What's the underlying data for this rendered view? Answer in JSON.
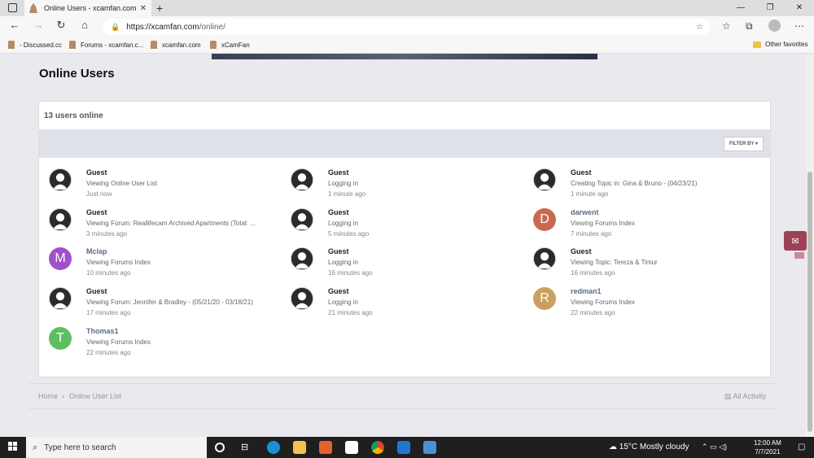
{
  "browser": {
    "tab_title": "Online Users - xcamfan.com",
    "tab_close": "✕",
    "new_tab": "+",
    "url_domain": "https://xcamfan.com",
    "url_path": "/online/",
    "bookmarks": [
      {
        "label": "- Discussed.cc"
      },
      {
        "label": "Forums - xcamfan.c..."
      },
      {
        "label": "xcamfan.com"
      },
      {
        "label": "xCamFan"
      }
    ],
    "other_favorites": "Other favorites"
  },
  "page": {
    "title": "Online Users",
    "count_label": "13 users online",
    "filter_label": "FILTER BY ▾",
    "users": [
      {
        "name": "Guest",
        "activity": "Viewing Online User List",
        "time": "Just now",
        "avatar": "guest",
        "col": 0,
        "row": 0
      },
      {
        "name": "Guest",
        "activity": "Logging in",
        "time": "1 minute ago",
        "avatar": "guest",
        "col": 1,
        "row": 0
      },
      {
        "name": "Guest",
        "activity": "Creating Topic in: Gina & Bruno - (04/23/21)",
        "time": "1 minute ago",
        "avatar": "guest",
        "col": 2,
        "row": 0
      },
      {
        "name": "Guest",
        "activity": "Viewing Forum: Reallifecam Archived Apartments (Total: ...",
        "time": "3 minutes ago",
        "avatar": "guest",
        "col": 0,
        "row": 1
      },
      {
        "name": "Guest",
        "activity": "Logging in",
        "time": "5 minutes ago",
        "avatar": "guest",
        "col": 1,
        "row": 1
      },
      {
        "name": "darwent",
        "activity": "Viewing Forums Index",
        "time": "7 minutes ago",
        "avatar": "D",
        "color": "#c96a50",
        "col": 2,
        "row": 1
      },
      {
        "name": "Mclap",
        "activity": "Viewing Forums Index",
        "time": "10 minutes ago",
        "avatar": "M",
        "color": "#a050c8",
        "col": 0,
        "row": 2
      },
      {
        "name": "Guest",
        "activity": "Logging in",
        "time": "16 minutes ago",
        "avatar": "guest",
        "col": 1,
        "row": 2
      },
      {
        "name": "Guest",
        "activity": "Viewing Topic: Tereza & Timur",
        "time": "16 minutes ago",
        "avatar": "guest",
        "col": 2,
        "row": 2
      },
      {
        "name": "Guest",
        "activity": "Viewing Forum: Jennifer & Bradley - (05/21/20 - 03/18/21)",
        "time": "17 minutes ago",
        "avatar": "guest",
        "col": 0,
        "row": 3
      },
      {
        "name": "Guest",
        "activity": "Logging in",
        "time": "21 minutes ago",
        "avatar": "guest",
        "col": 1,
        "row": 3
      },
      {
        "name": "redman1",
        "activity": "Viewing Forums Index",
        "time": "22 minutes ago",
        "avatar": "R",
        "color": "#c8a060",
        "col": 2,
        "row": 3
      },
      {
        "name": "Thomas1",
        "activity": "Viewing Forums Index",
        "time": "22 minutes ago",
        "avatar": "T",
        "color": "#5cc060",
        "col": 0,
        "row": 4
      }
    ],
    "breadcrumb_home": "Home",
    "breadcrumb_sep": "›",
    "breadcrumb_current": "Online User List",
    "all_activity": "All Activity"
  },
  "taskbar": {
    "search_placeholder": "Type here to search",
    "weather": "15°C  Mostly cloudy",
    "time": "12:00 AM",
    "date": "7/7/2021"
  }
}
